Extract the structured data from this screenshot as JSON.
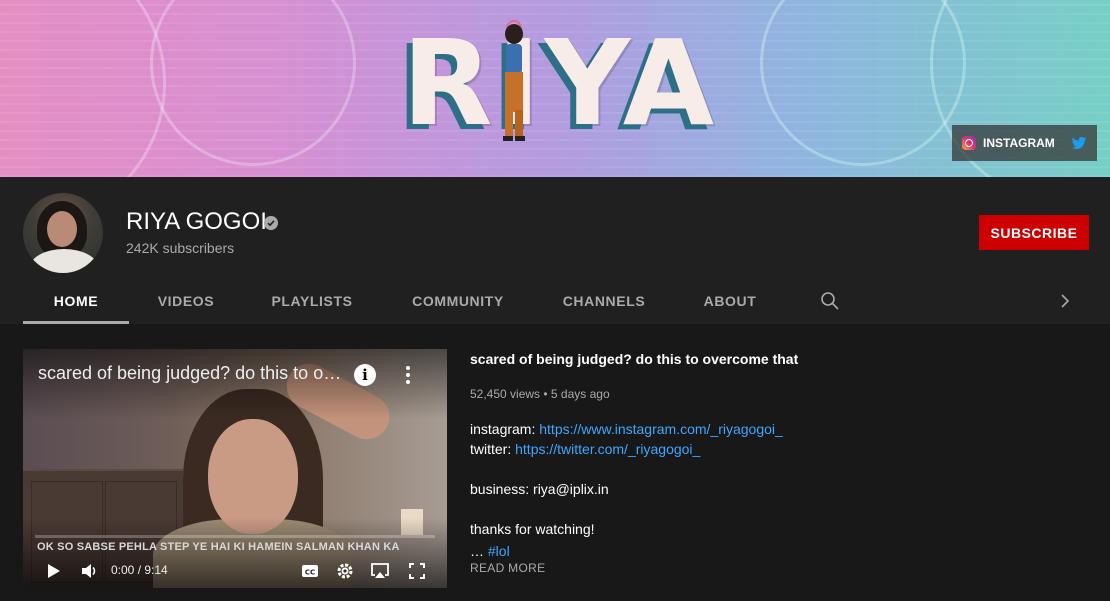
{
  "colors": {
    "accent": "#cc0000",
    "link": "#3ea6ff",
    "background": "#181818",
    "header": "#202020"
  },
  "banner": {
    "title": "RIYA",
    "links": [
      {
        "label": "INSTAGRAM",
        "icon": "instagram-icon"
      },
      {
        "label": "",
        "icon": "twitter-icon"
      }
    ]
  },
  "channel": {
    "name": "RIYA GOGOI",
    "subscribers": "242K subscribers",
    "subscribe_label": "SUBSCRIBE",
    "verified_icon": "verified-check-icon"
  },
  "tabs": [
    {
      "label": "HOME",
      "active": true
    },
    {
      "label": "VIDEOS"
    },
    {
      "label": "PLAYLISTS"
    },
    {
      "label": "COMMUNITY"
    },
    {
      "label": "CHANNELS"
    },
    {
      "label": "ABOUT"
    }
  ],
  "tab_icons": {
    "search": "search-icon",
    "next": "chevron-right-icon"
  },
  "featured": {
    "player": {
      "title": "scared of being judged? do this to overcome that",
      "caption": "OK SO SABSE PEHLA STEP YE HAI KI HAMEIN SALMAN KHAN KA",
      "time": "0:00 / 9:14",
      "info_glyph": "i"
    },
    "title": "scared of being judged? do this to overcome that",
    "meta": "52,450 views • 5 days ago",
    "description": {
      "instagram_label": "instagram:",
      "instagram_url": "https://www.instagram.com/_riyagogoi_",
      "twitter_label": "twitter:",
      "twitter_url": "https://twitter.com/_riyagogoi_",
      "business": "business: riya@iplix.in",
      "thanks": "thanks for watching!",
      "ellipsis": "…",
      "hashtag": "#lol"
    },
    "read_more": "READ MORE"
  }
}
